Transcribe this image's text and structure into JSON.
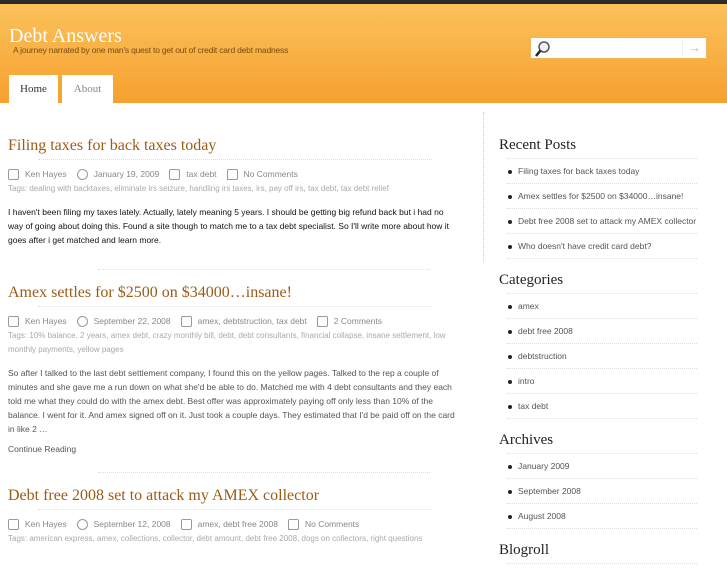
{
  "header": {
    "title": "Debt Answers",
    "tagline": "A journey narrated by one man's quest to get out of credit card debt madness",
    "search_placeholder": "",
    "search_value": ""
  },
  "nav": {
    "tabs": [
      {
        "label": "Home",
        "active": true
      },
      {
        "label": "About",
        "active": false
      }
    ]
  },
  "posts": [
    {
      "title": "Filing taxes for back taxes today",
      "author": "Ken Hayes",
      "date": "January 19, 2009",
      "categories": "tax debt",
      "comments": "No Comments",
      "tags": "Tags: dealing with backtaxes, eliminate irs seizure, handling irs taxes, irs, pay off irs, tax debt, tax debt relief",
      "body": "I haven't been filing my taxes lately.   Actually, lately meaning 5 years.  I should be getting big refund back but i had no way of going about doing this.  Found a site though to match me  to a tax debt specialist. So I'll write more about how it goes after i get matched and learn more."
    },
    {
      "title": "Amex settles for $2500 on $34000…insane!",
      "author": "Ken Hayes",
      "date": "September 22, 2008",
      "categories": "amex, debtstruction, tax debt",
      "comments": "2 Comments",
      "tags": "Tags: 10% balance, 2 years, amex debt, crazy monthly bill, debt, debt consultants, financial collapse, insane settlement, low monthly payments, yellow pages",
      "body": "So after I talked to the last debt settlement company, I found this on the yellow pages.  Talked to the rep a couple of minutes and she gave me a run down on what she'd be able to do.  Matched me with 4 debt consultants and they each told me what they could do with the amex debt. Best offer was approximately paying off only less than 10% of the balance.  I went for it.  And amex signed off on it.  Just took a couple days.  They estimated that I'd be paid off on the card in like 2 …",
      "continue": "Continue Reading"
    },
    {
      "title": "Debt free 2008 set to attack my AMEX collector",
      "author": "Ken Hayes",
      "date": "September 12, 2008",
      "categories": "amex, debt free 2008",
      "comments": "No Comments",
      "tags": "Tags: american express, amex, collections, collector, debt amount, debt free 2008, dogs on collectors, right questions"
    }
  ],
  "sidebar": {
    "recent": {
      "title": "Recent Posts",
      "items": [
        "Filing taxes for back taxes today",
        "Amex settles for $2500 on $34000…insane!",
        "Debt free 2008 set to attack my AMEX collector",
        "Who doesn't have credit card debt?"
      ]
    },
    "categories": {
      "title": "Categories",
      "items": [
        "amex",
        "debt free 2008",
        "debtstruction",
        "intro",
        "tax debt"
      ]
    },
    "archives": {
      "title": "Archives",
      "items": [
        "January 2009",
        "September 2008",
        "August 2008"
      ]
    },
    "blogroll": {
      "title": "Blogroll"
    }
  }
}
